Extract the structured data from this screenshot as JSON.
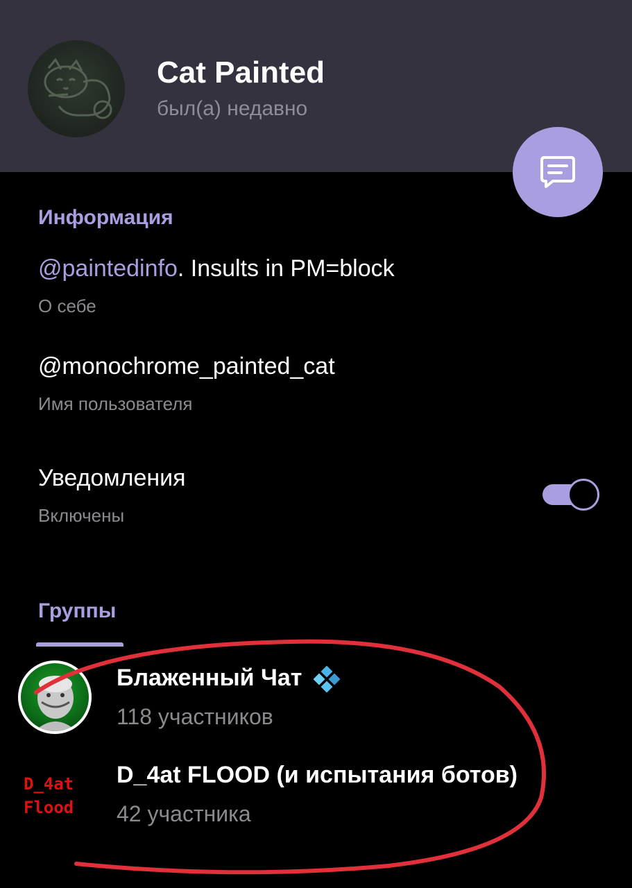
{
  "profile": {
    "name": "Cat Painted",
    "status": "был(а) недавно"
  },
  "info": {
    "section_title": "Информация",
    "bio": {
      "link": "@paintedinfo",
      "text": ". Insults in PM=block",
      "label": "О себе"
    },
    "username": {
      "value": "@monochrome_painted_cat",
      "label": "Имя пользователя"
    },
    "notifications": {
      "title": "Уведомления",
      "state": "Включены",
      "enabled": true
    }
  },
  "groups": {
    "tab_label": "Группы",
    "items": [
      {
        "name": "Блаженный Чат",
        "members": "118 участников",
        "badge_icon": "blue-diamond-icon"
      },
      {
        "name": "D_4at FLOOD (и испытания ботов)",
        "members": "42 участника",
        "avatar_text_line1": "D_4at",
        "avatar_text_line2": "Flood"
      }
    ]
  },
  "colors": {
    "header_bg": "#34323f",
    "accent": "#a99fe0",
    "background": "#000000",
    "secondary_text": "#8a8a8f",
    "annotation_red": "#e0303a"
  },
  "icons": {
    "fab": "message-bubble-icon"
  }
}
